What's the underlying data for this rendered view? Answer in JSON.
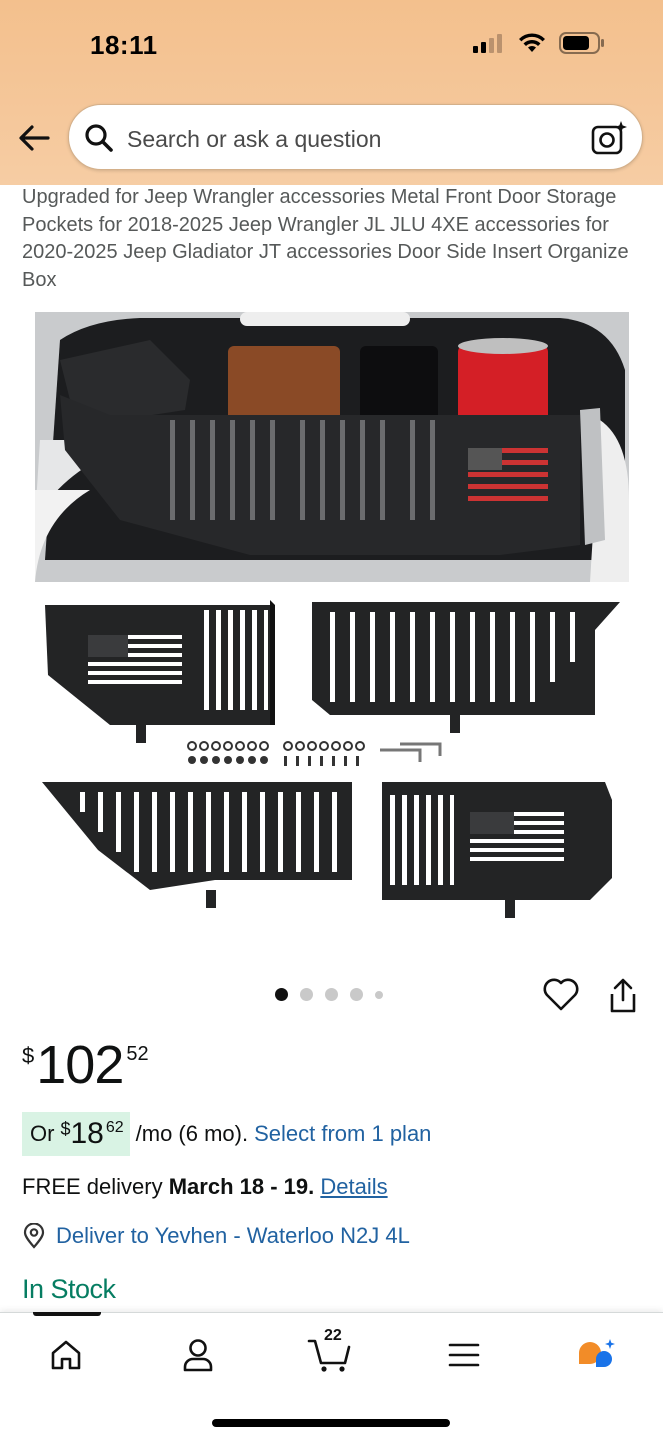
{
  "status_bar": {
    "time": "18:11"
  },
  "search": {
    "placeholder": "Search or ask a question"
  },
  "product": {
    "title": "Upgraded for Jeep Wrangler accessories Metal Front Door Storage Pockets for 2018-2025 Jeep Wrangler JL JLU 4XE accessories for 2020-2025 Jeep Gladiator JT accessories Door Side Insert Organize Box",
    "carousel": {
      "total": 5,
      "active": 0
    }
  },
  "price": {
    "symbol": "$",
    "whole": "102",
    "fraction": "52"
  },
  "installment": {
    "prefix": "Or",
    "symbol": "$",
    "whole": "18",
    "fraction": "62",
    "term": "/mo (6 mo).",
    "link": "Select from 1 plan"
  },
  "delivery": {
    "prefix": "FREE delivery",
    "dates": "March 18 - 19.",
    "link": "Details"
  },
  "deliver_to": {
    "text": "Deliver to Yevhen - Waterloo N2J 4L"
  },
  "stock": {
    "text": "In Stock"
  },
  "bottom_nav": {
    "cart_count": "22"
  },
  "colors": {
    "header_bg": "#f5c79a",
    "link": "#2162a1",
    "in_stock": "#067d62",
    "installment_bg": "#d9f3e4",
    "rufus_orange": "#f28c28",
    "rufus_blue": "#1a73e8"
  }
}
